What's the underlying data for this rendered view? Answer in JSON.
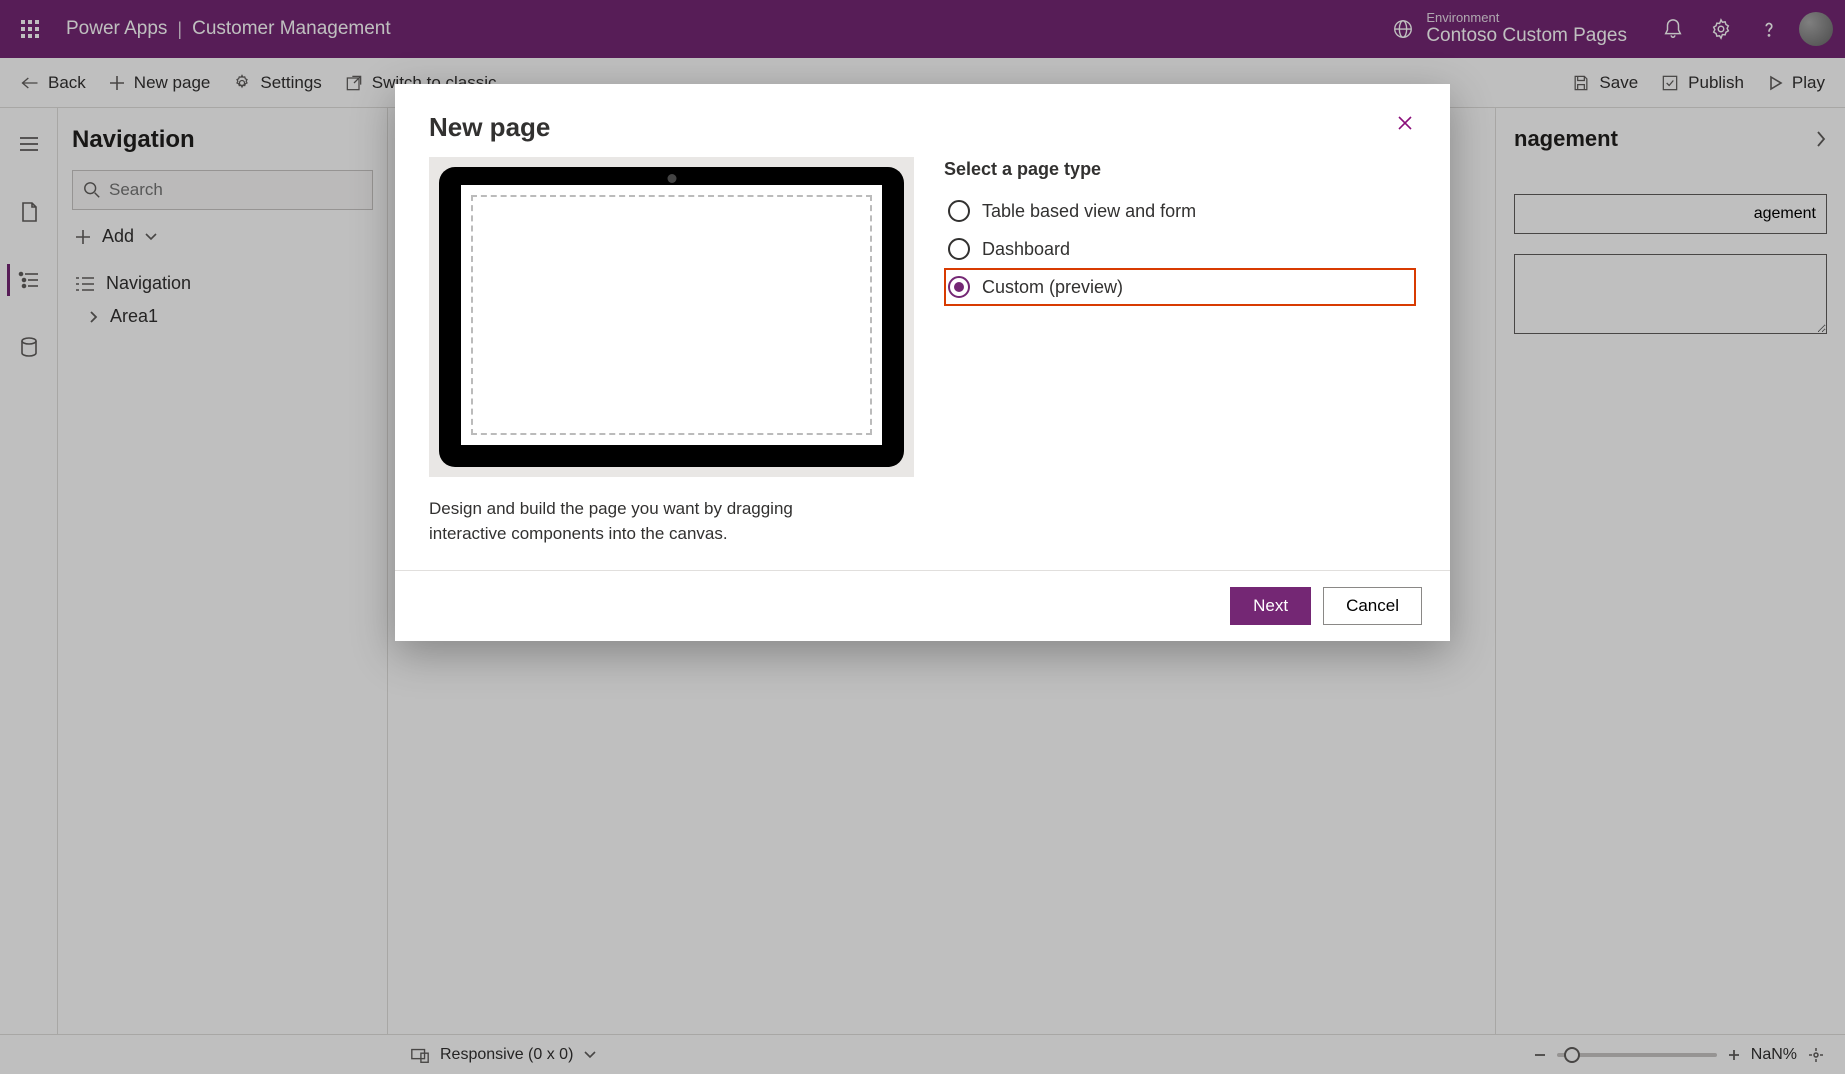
{
  "header": {
    "product": "Power Apps",
    "separator": "|",
    "app_name": "Customer Management",
    "env_label": "Environment",
    "env_name": "Contoso Custom Pages"
  },
  "cmdbar": {
    "back": "Back",
    "new_page": "New page",
    "settings": "Settings",
    "switch_classic": "Switch to classic",
    "save": "Save",
    "publish": "Publish",
    "play": "Play"
  },
  "nav": {
    "title": "Navigation",
    "search_placeholder": "Search",
    "add_label": "Add",
    "root": "Navigation",
    "area1": "Area1"
  },
  "props": {
    "title_suffix": "nagement",
    "name_value_suffix": "gement",
    "value2_suffix": "agement"
  },
  "status": {
    "responsive": "Responsive (0 x 0)",
    "zoom": "NaN%"
  },
  "modal": {
    "title": "New page",
    "description": "Design and build the page you want by dragging interactive components into the canvas.",
    "select_label": "Select a page type",
    "options": {
      "table": "Table based view and form",
      "dashboard": "Dashboard",
      "custom": "Custom (preview)"
    },
    "next": "Next",
    "cancel": "Cancel"
  }
}
